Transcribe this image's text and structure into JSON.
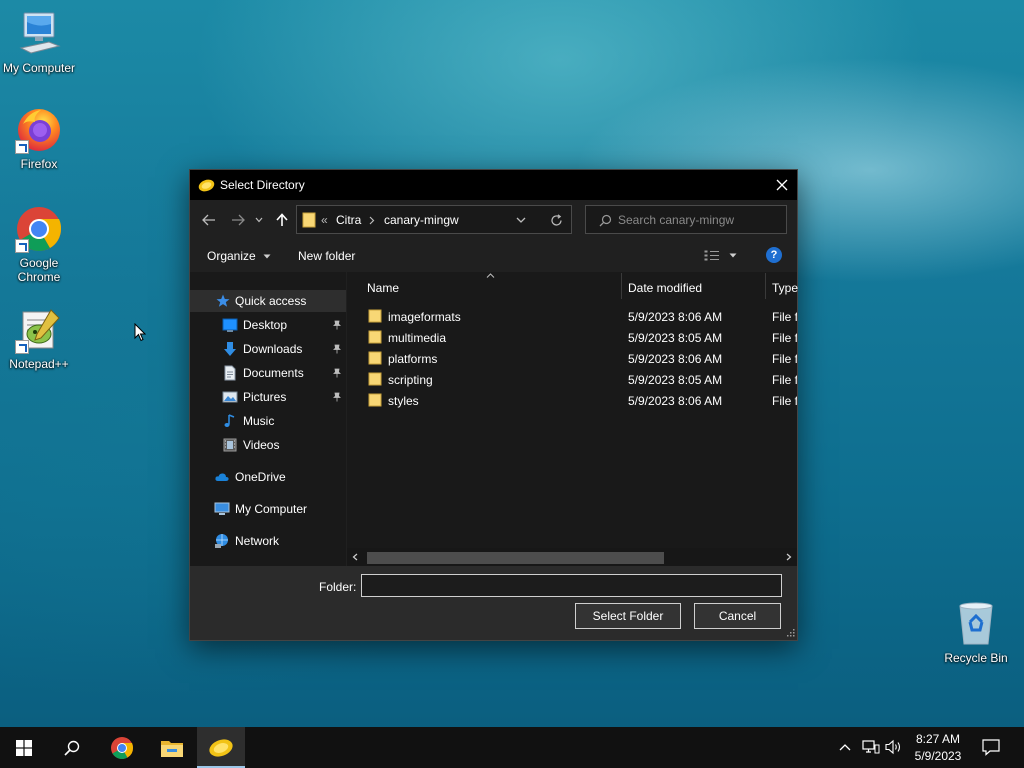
{
  "desktop": {
    "icons": [
      {
        "label": "My Computer"
      },
      {
        "label": "Firefox"
      },
      {
        "label": "Google Chrome"
      },
      {
        "label": "Notepad++"
      },
      {
        "label": "Recycle Bin"
      }
    ]
  },
  "dialog": {
    "title": "Select Directory",
    "address": {
      "overflow": "«",
      "segments": [
        "Citra",
        "canary-mingw"
      ]
    },
    "search_placeholder": "Search canary-mingw",
    "toolbar": {
      "organize": "Organize",
      "new_folder": "New folder"
    },
    "nav": {
      "quick_access": "Quick access",
      "items": [
        {
          "label": "Desktop",
          "pinned": true
        },
        {
          "label": "Downloads",
          "pinned": true
        },
        {
          "label": "Documents",
          "pinned": true
        },
        {
          "label": "Pictures",
          "pinned": true
        },
        {
          "label": "Music",
          "pinned": false
        },
        {
          "label": "Videos",
          "pinned": false
        }
      ],
      "onedrive": "OneDrive",
      "my_computer": "My Computer",
      "network": "Network"
    },
    "columns": {
      "name": "Name",
      "date_modified": "Date modified",
      "type": "Type"
    },
    "files": [
      {
        "name": "imageformats",
        "date": "5/9/2023 8:06 AM",
        "type": "File folder"
      },
      {
        "name": "multimedia",
        "date": "5/9/2023 8:05 AM",
        "type": "File folder"
      },
      {
        "name": "platforms",
        "date": "5/9/2023 8:06 AM",
        "type": "File folder"
      },
      {
        "name": "scripting",
        "date": "5/9/2023 8:05 AM",
        "type": "File folder"
      },
      {
        "name": "styles",
        "date": "5/9/2023 8:06 AM",
        "type": "File folder"
      }
    ],
    "folder_label": "Folder:",
    "folder_value": "",
    "buttons": {
      "select": "Select Folder",
      "cancel": "Cancel"
    }
  },
  "taskbar": {
    "time": "8:27 AM",
    "date": "5/9/2023"
  }
}
